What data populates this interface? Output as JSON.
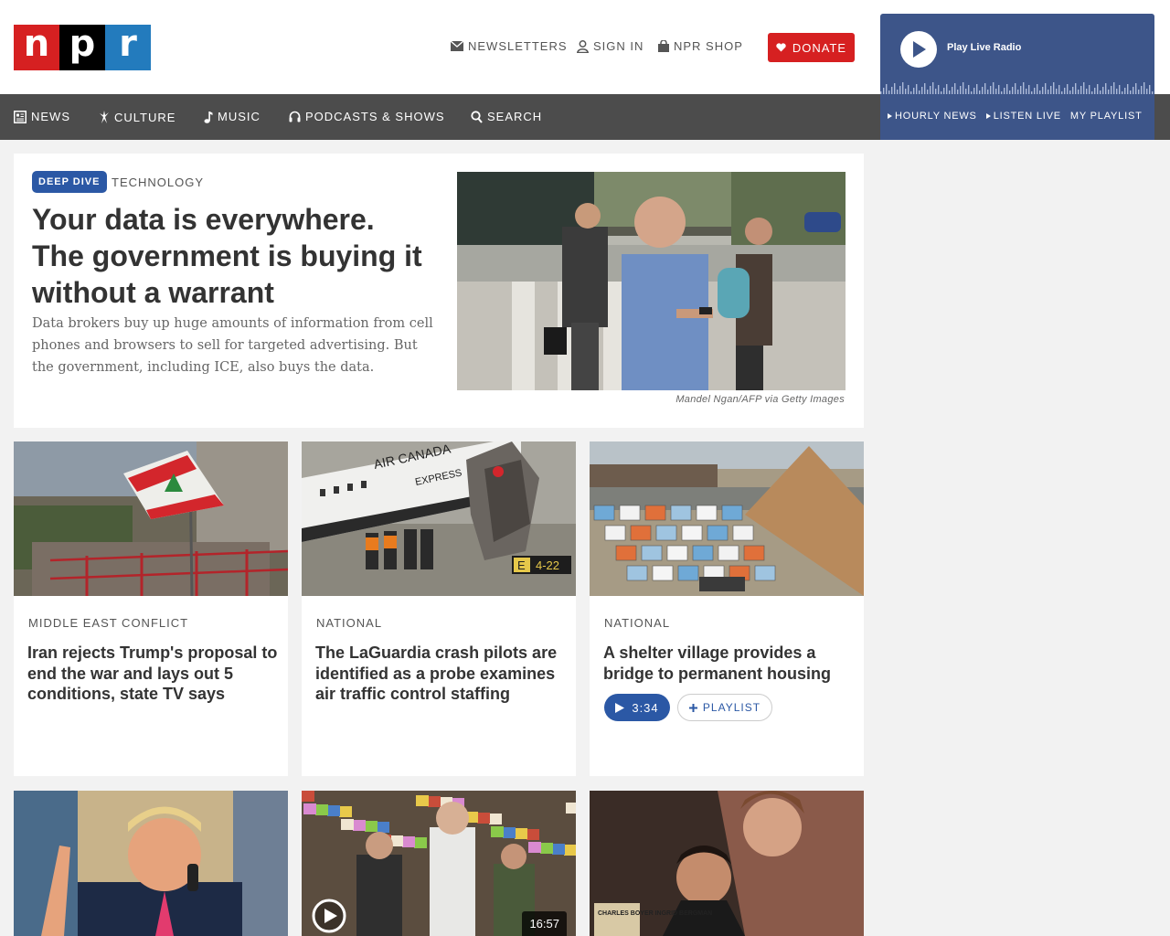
{
  "brand": {
    "letters": [
      "n",
      "p",
      "r"
    ],
    "colors": [
      "#d62021",
      "#000000",
      "#237bbd"
    ]
  },
  "utility": {
    "newsletters": "NEWSLETTERS",
    "sign_in": "SIGN IN",
    "shop": "NPR SHOP",
    "donate": "DONATE"
  },
  "nav": {
    "items": [
      {
        "label": "NEWS",
        "icon": "news-icon"
      },
      {
        "label": "CULTURE",
        "icon": "culture-icon"
      },
      {
        "label": "MUSIC",
        "icon": "music-note-icon"
      },
      {
        "label": "PODCASTS & SHOWS",
        "icon": "headphones-icon"
      },
      {
        "label": "SEARCH",
        "icon": "search-icon"
      }
    ]
  },
  "player": {
    "live_label": "Play Live Radio",
    "links": [
      "HOURLY NEWS",
      "LISTEN LIVE",
      "MY PLAYLIST"
    ]
  },
  "feature": {
    "badge": "DEEP DIVE",
    "slug": "TECHNOLOGY",
    "headline": "Your data is everywhere. The government is buying it without a warrant",
    "teaser": "Data brokers buy up huge amounts of information from cell phones and browsers to sell for targeted advertising. But the government, including ICE, also buys the data.",
    "credit": "Mandel Ngan/AFP via Getty Images"
  },
  "cards": [
    {
      "kicker": "MIDDLE EAST CONFLICT",
      "headline": "Iran rejects Trump's proposal to end the war and lays out 5 conditions, state TV says"
    },
    {
      "kicker": "NATIONAL",
      "headline": "The LaGuardia crash pilots are identified as a probe examines air traffic control staffing"
    },
    {
      "kicker": "NATIONAL",
      "headline": "A shelter village provides a bridge to permanent housing",
      "audio_duration": "3:34",
      "playlist_label": "PLAYLIST"
    }
  ],
  "bottom": {
    "video_duration": "16:57"
  },
  "photo_text": {
    "airline": "AIR CANADA",
    "airline_sub": "EXPRESS",
    "runway_sign": "4-22",
    "runway_letter": "E",
    "poster_names": "CHARLES BOYER INGRID BERGMAN"
  },
  "colors": {
    "accent_blue": "#2b58a5",
    "donate_red": "#d62021",
    "nav_bg": "#4c4c4c",
    "player_bg": "#3d5589"
  }
}
